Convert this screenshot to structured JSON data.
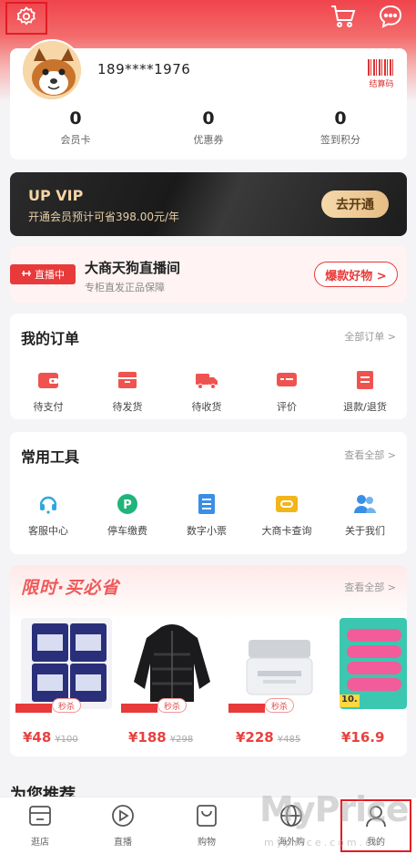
{
  "header": {
    "settings_icon": "gear-icon",
    "cart_icon": "cart-icon",
    "message_icon": "chat-bubble-icon"
  },
  "profile": {
    "phone": "189****1976",
    "barcode_label": "结算码",
    "stats": [
      {
        "value": "0",
        "label": "会员卡"
      },
      {
        "value": "0",
        "label": "优惠券"
      },
      {
        "value": "0",
        "label": "签到积分"
      }
    ]
  },
  "vip": {
    "title": "UP VIP",
    "subtitle": "开通会员预计可省398.00元/年",
    "button": "去开通"
  },
  "live": {
    "badge": "直播中",
    "title": "大商天狗直播间",
    "subtitle": "专柜直发正品保障",
    "button": "爆款好物 >"
  },
  "orders": {
    "title": "我的订单",
    "more": "全部订单 >",
    "items": [
      {
        "label": "待支付",
        "icon": "wallet-icon"
      },
      {
        "label": "待发货",
        "icon": "package-icon"
      },
      {
        "label": "待收货",
        "icon": "truck-icon"
      },
      {
        "label": "评价",
        "icon": "comment-icon"
      },
      {
        "label": "退款/退货",
        "icon": "refund-icon"
      }
    ]
  },
  "tools": {
    "title": "常用工具",
    "more": "查看全部 >",
    "items": [
      {
        "label": "客服中心",
        "icon": "headset-icon"
      },
      {
        "label": "停车缴费",
        "icon": "parking-icon"
      },
      {
        "label": "数字小票",
        "icon": "receipt-icon"
      },
      {
        "label": "大商卡查询",
        "icon": "card-icon"
      },
      {
        "label": "关于我们",
        "icon": "people-icon"
      }
    ]
  },
  "deals": {
    "title": "限时·买必省",
    "more": "查看全部 >",
    "sale_tag": "秒杀",
    "products": [
      {
        "price": "¥48",
        "old_price": "¥100"
      },
      {
        "price": "¥188",
        "old_price": "¥298"
      },
      {
        "price": "¥228",
        "old_price": "¥485"
      },
      {
        "price": "¥16.9",
        "old_price": ""
      }
    ],
    "product4_badge": "10."
  },
  "recommend_title": "为您推荐",
  "tabbar": {
    "items": [
      {
        "label": "逛店",
        "icon": "store-icon"
      },
      {
        "label": "直播",
        "icon": "play-icon"
      },
      {
        "label": "购物",
        "icon": "bag-icon"
      },
      {
        "label": "海外购",
        "icon": "globe-icon"
      },
      {
        "label": "我的",
        "icon": "user-icon"
      }
    ]
  },
  "watermark": {
    "text": "MyPrice",
    "sub": "myprice.com.cn"
  },
  "colors": {
    "brand_red": "#e8413f",
    "vip_gold": "#f4d5a6"
  }
}
